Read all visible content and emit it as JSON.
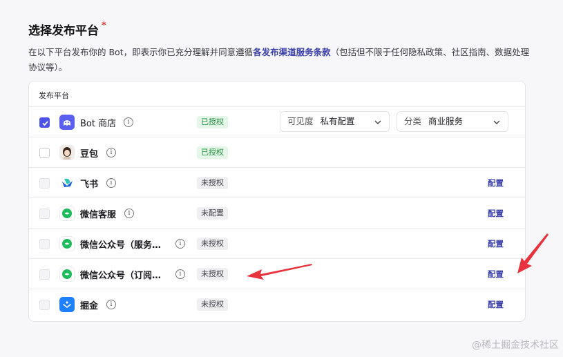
{
  "section": {
    "title": "选择发布平台",
    "required_mark": "*",
    "desc_before": "在以下平台发布你的 Bot，即表示你已充分理解并同意遵循",
    "desc_link": "各发布渠道服务条款",
    "desc_after": "（包括但不限于任何隐私政策、社区指南、数据处理协议等）。"
  },
  "table": {
    "header": "发布平台",
    "rows": [
      {
        "name": "Bot 商店",
        "icon": "bot-store-icon",
        "checked": true,
        "status": "已授权",
        "status_type": "ok"
      },
      {
        "name": "豆包",
        "icon": "doubao-avatar-icon",
        "checked": false,
        "status": "已授权",
        "status_type": "ok"
      },
      {
        "name": "飞书",
        "icon": "feishu-icon",
        "checked": false,
        "status": "未授权",
        "status_type": "no",
        "action": "配置"
      },
      {
        "name": "微信客服",
        "icon": "wechat-icon",
        "checked": false,
        "status": "未配置",
        "status_type": "no",
        "action": "配置"
      },
      {
        "name": "微信公众号（服务…",
        "icon": "wechat-icon",
        "checked": false,
        "status": "未授权",
        "status_type": "no",
        "action": "配置"
      },
      {
        "name": "微信公众号（订阅…",
        "icon": "wechat-icon",
        "checked": false,
        "status": "未授权",
        "status_type": "no",
        "action": "配置"
      },
      {
        "name": "掘金",
        "icon": "juejin-icon",
        "checked": false,
        "status": "未授权",
        "status_type": "no",
        "action": "配置"
      }
    ],
    "visibility": {
      "label": "可见度",
      "value": "私有配置"
    },
    "category": {
      "label": "分类",
      "value": "商业服务"
    }
  },
  "colors": {
    "accent": "#4d53e8",
    "link": "#3b3fa8",
    "annotation": "#e8333f"
  },
  "watermark": "@稀土掘金技术社区"
}
